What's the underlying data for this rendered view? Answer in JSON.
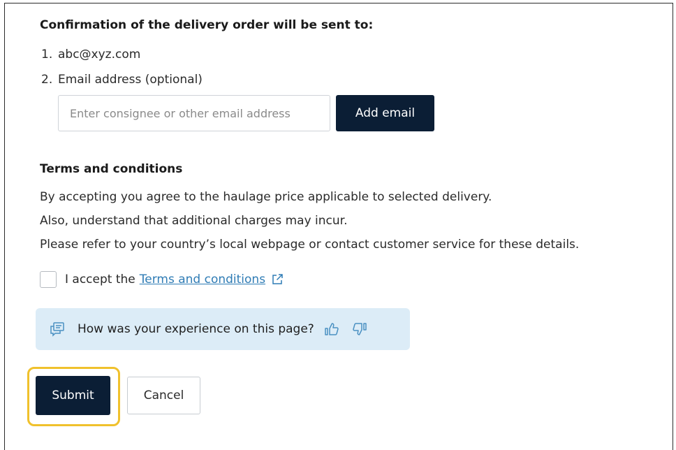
{
  "confirmation": {
    "heading": "Confirmation of the delivery order will be sent to:",
    "items": [
      {
        "number": "1.",
        "text": "abc@xyz.com"
      },
      {
        "number": "2.",
        "text": "Email address (optional)"
      }
    ],
    "email_input": {
      "value": "",
      "placeholder": "Enter consignee or other email address"
    },
    "add_email_label": "Add email"
  },
  "terms": {
    "heading": "Terms and conditions",
    "paragraphs": [
      "By accepting you agree to the haulage price applicable to selected delivery.",
      "Also, understand that additional charges may incur.",
      "Please refer to your country’s local webpage or contact customer service for these details."
    ],
    "accept_prefix": "I accept the",
    "accept_link": "Terms and conditions",
    "accepted": false
  },
  "feedback": {
    "question": "How was your experience on this page?",
    "icons": [
      "feedback-chat-icon",
      "thumbs-up-icon",
      "thumbs-down-icon"
    ]
  },
  "actions": {
    "submit_label": "Submit",
    "cancel_label": "Cancel"
  },
  "colors": {
    "primary_button": "#0b1e35",
    "link": "#2f7cb5",
    "feedback_bg": "#dcecf7",
    "highlight_ring": "#f0c12c"
  }
}
